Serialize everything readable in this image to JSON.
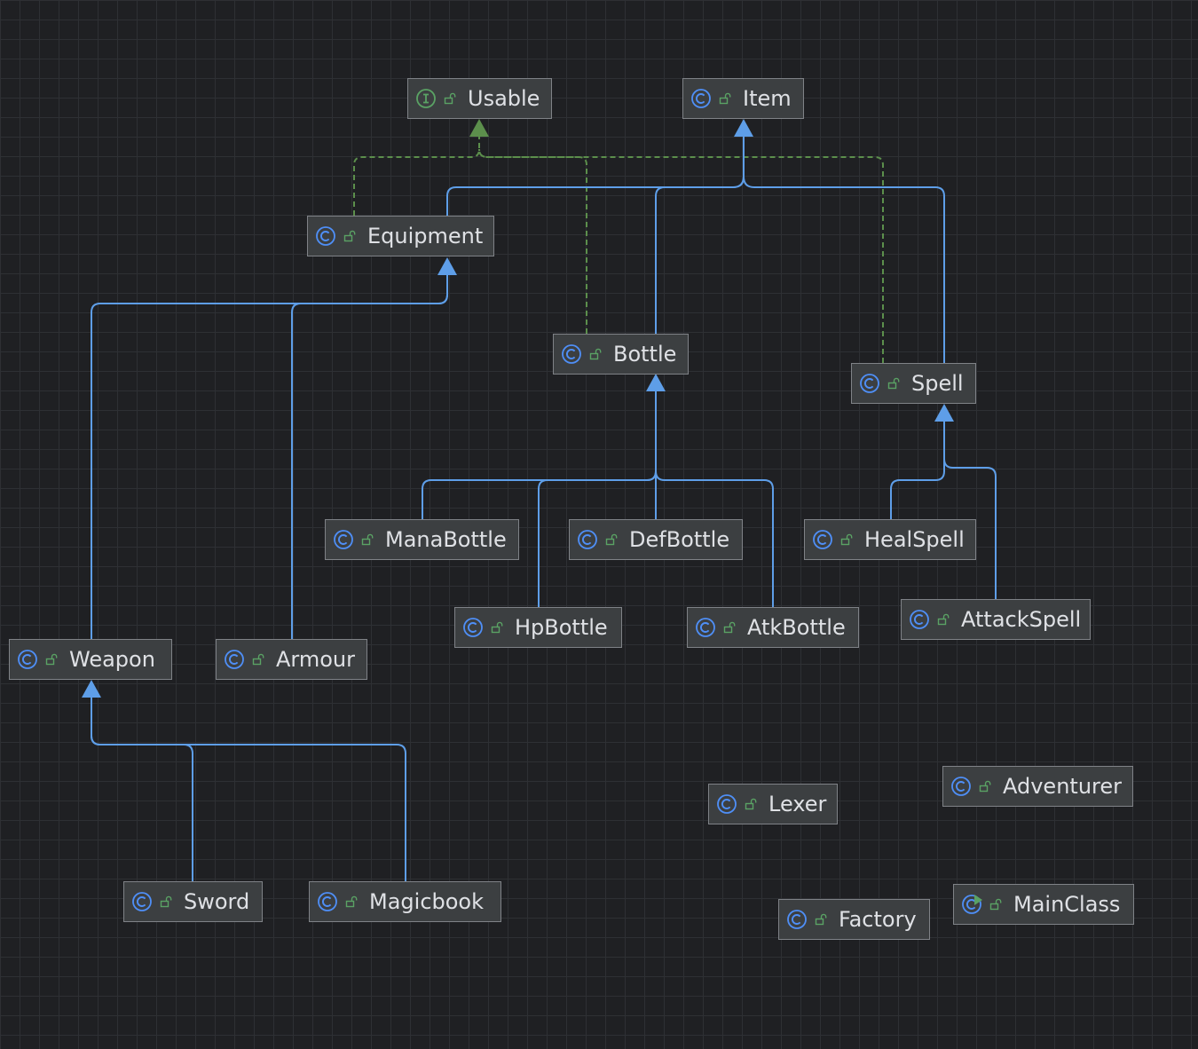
{
  "diagram": {
    "colors": {
      "background": "#1f2023",
      "node_fill": "#3c3f41",
      "node_border": "#7f8287",
      "label": "#dfe1e5",
      "extends_edge": "#5e9ee8",
      "implements_edge": "#5c8f4c",
      "class_icon": "#4f8ff7",
      "interface_icon": "#5aa264",
      "visibility_icon": "#5aa264"
    },
    "nodes": [
      {
        "id": "usable",
        "name": "Usable",
        "kind": "interface",
        "icon": "interface-icon"
      },
      {
        "id": "item",
        "name": "Item",
        "kind": "class",
        "icon": "class-icon"
      },
      {
        "id": "equipment",
        "name": "Equipment",
        "kind": "class",
        "icon": "class-icon"
      },
      {
        "id": "bottle",
        "name": "Bottle",
        "kind": "class",
        "icon": "class-icon"
      },
      {
        "id": "spell",
        "name": "Spell",
        "kind": "class",
        "icon": "class-icon"
      },
      {
        "id": "manabottle",
        "name": "ManaBottle",
        "kind": "class",
        "icon": "class-icon"
      },
      {
        "id": "defbottle",
        "name": "DefBottle",
        "kind": "class",
        "icon": "class-icon"
      },
      {
        "id": "healspell",
        "name": "HealSpell",
        "kind": "class",
        "icon": "class-icon"
      },
      {
        "id": "hpbottle",
        "name": "HpBottle",
        "kind": "class",
        "icon": "class-icon"
      },
      {
        "id": "atkbottle",
        "name": "AtkBottle",
        "kind": "class",
        "icon": "class-icon"
      },
      {
        "id": "attackspell",
        "name": "AttackSpell",
        "kind": "class",
        "icon": "class-icon"
      },
      {
        "id": "weapon",
        "name": "Weapon",
        "kind": "class",
        "icon": "class-icon"
      },
      {
        "id": "armour",
        "name": "Armour",
        "kind": "class",
        "icon": "class-icon"
      },
      {
        "id": "adventurer",
        "name": "Adventurer",
        "kind": "class",
        "icon": "class-icon"
      },
      {
        "id": "lexer",
        "name": "Lexer",
        "kind": "class",
        "icon": "class-icon"
      },
      {
        "id": "sword",
        "name": "Sword",
        "kind": "class",
        "icon": "class-icon"
      },
      {
        "id": "magicbook",
        "name": "Magicbook",
        "kind": "class",
        "icon": "class-icon"
      },
      {
        "id": "mainclass",
        "name": "MainClass",
        "kind": "main-class",
        "icon": "main-class-icon"
      },
      {
        "id": "factory",
        "name": "Factory",
        "kind": "class",
        "icon": "class-icon"
      }
    ],
    "edges": [
      {
        "from": "equipment",
        "to": "item",
        "type": "extends"
      },
      {
        "from": "bottle",
        "to": "item",
        "type": "extends"
      },
      {
        "from": "spell",
        "to": "item",
        "type": "extends"
      },
      {
        "from": "equipment",
        "to": "usable",
        "type": "implements"
      },
      {
        "from": "bottle",
        "to": "usable",
        "type": "implements"
      },
      {
        "from": "spell",
        "to": "usable",
        "type": "implements"
      },
      {
        "from": "weapon",
        "to": "equipment",
        "type": "extends"
      },
      {
        "from": "armour",
        "to": "equipment",
        "type": "extends"
      },
      {
        "from": "manabottle",
        "to": "bottle",
        "type": "extends"
      },
      {
        "from": "hpbottle",
        "to": "bottle",
        "type": "extends"
      },
      {
        "from": "defbottle",
        "to": "bottle",
        "type": "extends"
      },
      {
        "from": "atkbottle",
        "to": "bottle",
        "type": "extends"
      },
      {
        "from": "healspell",
        "to": "spell",
        "type": "extends"
      },
      {
        "from": "attackspell",
        "to": "spell",
        "type": "extends"
      },
      {
        "from": "sword",
        "to": "weapon",
        "type": "extends"
      },
      {
        "from": "magicbook",
        "to": "weapon",
        "type": "extends"
      }
    ]
  }
}
